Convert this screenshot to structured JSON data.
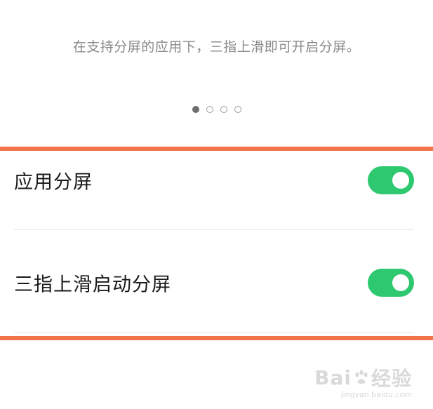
{
  "hint_text": "在支持分屏的应用下，三指上滑即可开启分屏。",
  "pager": {
    "total": 4,
    "active_index": 0
  },
  "settings": [
    {
      "label": "应用分屏",
      "enabled": true
    },
    {
      "label": "三指上滑启动分屏",
      "enabled": true
    }
  ],
  "watermark": {
    "logo_text": "Bai",
    "logo_text_after": "经验",
    "url": "jingyan.baidu.com"
  },
  "colors": {
    "toggle_on": "#2dc86f",
    "highlight": "#f2744b",
    "hint_text": "#8a8a8a"
  }
}
